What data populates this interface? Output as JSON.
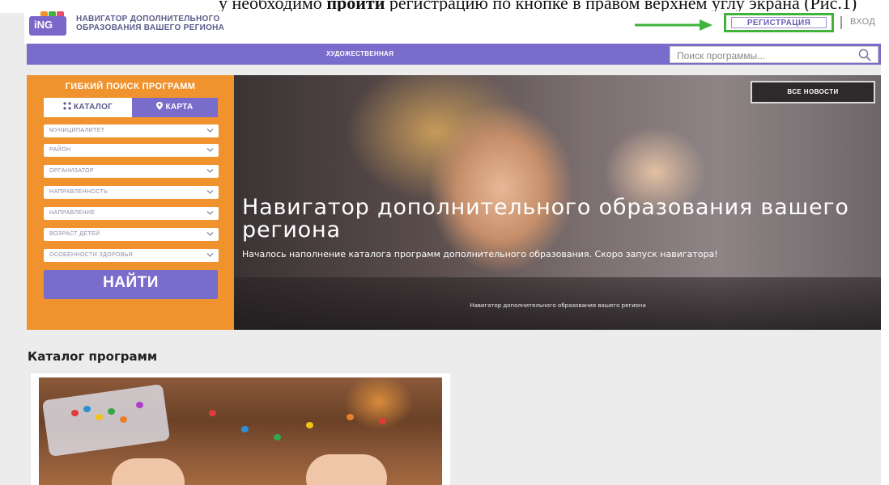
{
  "doc_text": {
    "before_bold": "у необходимо ",
    "bold": "пройти",
    "after_bold": " регистрацию по кнопке в правом верхнем углу экрана (Рис.1)"
  },
  "header": {
    "logo_text": "iNG",
    "brand_line1": "НАВИГАТОР ДОПОЛНИТЕЛЬНОГО",
    "brand_line2": "ОБРАЗОВАНИЯ ВАШЕГО РЕГИОНА",
    "register_label": "РЕГИСТРАЦИЯ",
    "login_label": "ВХОД",
    "highlight_color": "#3fb33a"
  },
  "nav": {
    "item": "ХУДОЖЕСТВЕННАЯ",
    "search_placeholder": "Поиск программы..."
  },
  "filter": {
    "title": "ГИБКИЙ ПОИСК ПРОГРАММ",
    "tab_catalog": "КАТАЛОГ",
    "tab_map": "КАРТА",
    "selects": [
      "МУНИЦИПАЛИТЕТ",
      "РАЙОН",
      "ОРГАНИЗАТОР",
      "НАПРАВЛЕННОСТЬ",
      "НАПРАВЛЕНИЕ",
      "ВОЗРАСТ ДЕТЕЙ",
      "ОСОБЕННОСТИ ЗДОРОВЬЯ"
    ],
    "find_label": "НАЙТИ",
    "panel_color": "#f0922d",
    "accent_color": "#7a6ccb"
  },
  "hero": {
    "all_news": "ВСЕ НОВОСТИ",
    "title": "Навигатор дополнительного образования вашего региона",
    "subtitle": "Началось наполнение каталога программ дополнительного образования. Скоро запуск навигатора!",
    "caption": "Навигатор дополнительного образования вашего региона"
  },
  "catalog": {
    "title": "Каталог программ"
  }
}
